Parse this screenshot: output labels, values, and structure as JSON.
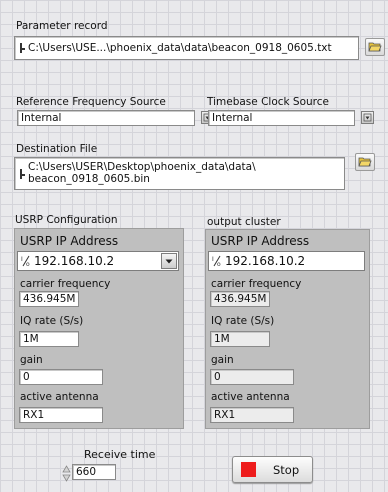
{
  "parameter_record": {
    "label": "Parameter record",
    "path_line": "C:\\Users\\USE...\\phoenix_data\\data\\beacon_0918_0605.txt"
  },
  "reference_frequency_source": {
    "label": "Reference Frequency Source",
    "value": "Internal"
  },
  "timebase_clock_source": {
    "label": "Timebase Clock Source",
    "value": "Internal"
  },
  "destination_file": {
    "label": "Destination File",
    "path_line1": "C:\\Users\\USER\\Desktop\\phoenix_data\\data\\",
    "path_line2": "beacon_0918_0605.bin"
  },
  "usrp_configuration": {
    "cluster_label": "USRP Configuration",
    "ip_header": "USRP IP Address",
    "ip_address": "192.168.10.2",
    "carrier_frequency_label": "carrier frequency",
    "carrier_frequency": "436.945M",
    "iq_rate_label": "IQ rate (S/s)",
    "iq_rate": "1M",
    "gain_label": "gain",
    "gain": "0",
    "active_antenna_label": "active antenna",
    "active_antenna": "RX1"
  },
  "output_cluster": {
    "cluster_label": "output cluster",
    "ip_header": "USRP IP Address",
    "ip_address": "192.168.10.2",
    "carrier_frequency_label": "carrier frequency",
    "carrier_frequency": "436.945M",
    "iq_rate_label": "IQ rate (S/s)",
    "iq_rate": "1M",
    "gain_label": "gain",
    "gain": "0",
    "active_antenna_label": "active antenna",
    "active_antenna": "RX1"
  },
  "receive_time": {
    "label": "Receive time",
    "value": "660"
  },
  "stop_button": {
    "label": "Stop"
  },
  "colors": {
    "stop_red": "#ee1c1c",
    "cluster_gray": "#bfbfbf",
    "folder_yellow": "#e8c43a"
  },
  "icons": {
    "browse": "folder-browse-icon",
    "path_marker": "path-icon",
    "io_marker": "io-constant-icon",
    "ring_arrow": "ring-dropdown-icon"
  }
}
